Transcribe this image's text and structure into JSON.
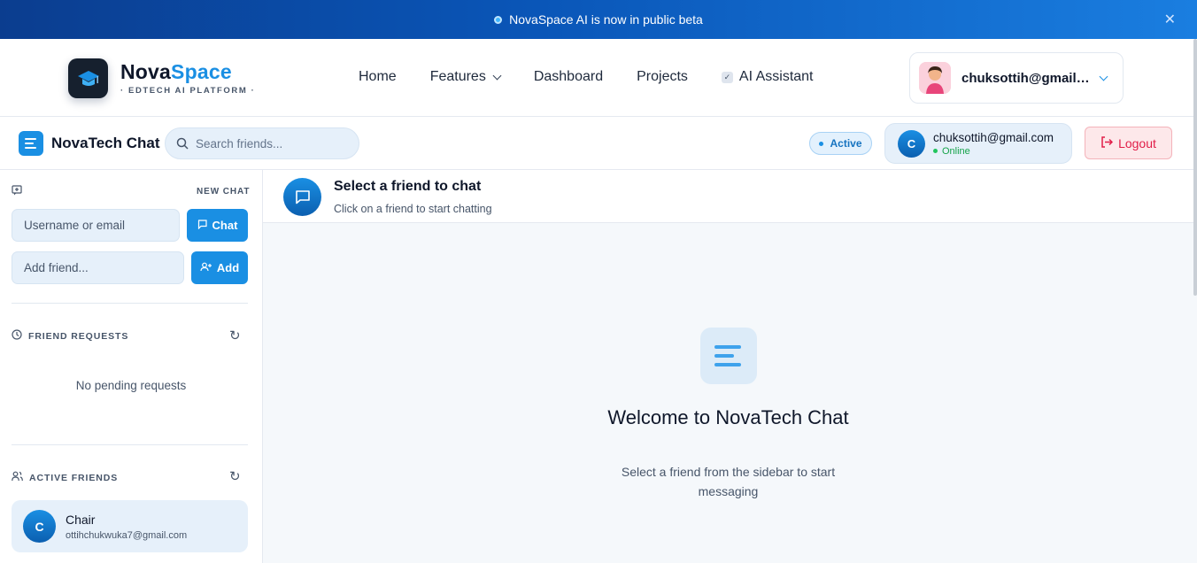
{
  "banner": {
    "text": "NovaSpace AI is now in public beta",
    "close": "✕"
  },
  "brand": {
    "name_part1": "Nova",
    "name_part2": "Space",
    "tagline": "· EDTECH AI PLATFORM ·"
  },
  "nav": {
    "home": "Home",
    "features": "Features",
    "dashboard": "Dashboard",
    "projects": "Projects",
    "ai_assistant": "AI Assistant"
  },
  "user_menu": {
    "email": "chuksottih@gmail.com"
  },
  "chat_header": {
    "title": "NovaTech Chat",
    "search_placeholder": "Search friends...",
    "status_badge": "Active",
    "me": {
      "initial": "C",
      "email": "chuksottih@gmail.com",
      "status": "Online"
    },
    "logout": "Logout"
  },
  "sidebar": {
    "new_chat_label": "NEW CHAT",
    "username_placeholder": "Username or email",
    "chat_button": "Chat",
    "add_friend_placeholder": "Add friend...",
    "add_button": "Add",
    "friend_requests_label": "FRIEND REQUESTS",
    "no_requests": "No pending requests",
    "active_friends_label": "ACTIVE FRIENDS",
    "friends": [
      {
        "initial": "C",
        "name": "Chair",
        "email": "ottihchukwuka7@gmail.com"
      }
    ]
  },
  "main": {
    "header_title": "Select a friend to chat",
    "header_subtitle": "Click on a friend to start chatting",
    "welcome_title": "Welcome to NovaTech Chat",
    "welcome_subtitle": "Select a friend from the sidebar to start messaging"
  },
  "colors": {
    "accent": "#1a8fe3",
    "danger": "#e11d48",
    "online": "#22c55e"
  }
}
